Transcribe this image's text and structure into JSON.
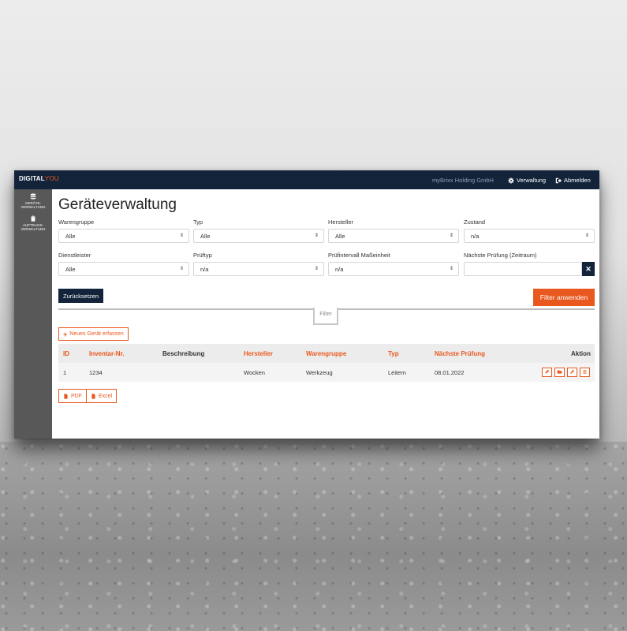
{
  "app": {
    "logo_part1": "DIGITAL",
    "logo_part2": "YOU",
    "company": "myBrixx Holding GmbH",
    "nav_admin": "Verwaltung",
    "nav_logout": "Abmelden"
  },
  "sidebar": {
    "items": [
      {
        "label": "GERÄTE-\nVERWALTUNG",
        "icon": "database-icon"
      },
      {
        "label": "AUFTRAGS-\nVERWALTUNG",
        "icon": "clipboard-icon"
      }
    ]
  },
  "page": {
    "title": "Geräteverwaltung"
  },
  "filters": {
    "warengruppe": {
      "label": "Warengruppe",
      "value": "Alle"
    },
    "typ": {
      "label": "Typ",
      "value": "Alle"
    },
    "hersteller": {
      "label": "Hersteller",
      "value": "Alle"
    },
    "zustand": {
      "label": "Zustand",
      "value": "n/a"
    },
    "dienstleister": {
      "label": "Dienstleister",
      "value": "Alle"
    },
    "prueftyp": {
      "label": "Prüftyp",
      "value": "n/a"
    },
    "pruefintervall": {
      "label": "Prüfintervall Maßeinheit",
      "value": "n/a"
    },
    "naechste_pruefung": {
      "label": "Nächste Prüfung (Zeitraum)",
      "value": ""
    },
    "clear_icon": "close-icon",
    "reset_label": "Zurücksetzen",
    "apply_label": "Filter anwenden",
    "toggle_label": "Filter"
  },
  "actions": {
    "new_device": "Neues Gerät erfassen",
    "pdf": "PDF",
    "excel": "Excel"
  },
  "table": {
    "headers": {
      "id": "ID",
      "inventar": "Inventar-Nr.",
      "beschreibung": "Beschreibung",
      "hersteller": "Hersteller",
      "warengruppe": "Warengruppe",
      "typ": "Typ",
      "naechste": "Nächste Prüfung",
      "aktion": "Aktion"
    },
    "rows": [
      {
        "id": "1",
        "inventar": "1234",
        "beschreibung": "",
        "hersteller": "Wocken",
        "warengruppe": "Werkzeug",
        "typ": "Leitern",
        "naechste": "08.01.2022"
      }
    ]
  },
  "colors": {
    "accent": "#e9581e",
    "navy": "#12233a",
    "sidebar": "#585858"
  }
}
